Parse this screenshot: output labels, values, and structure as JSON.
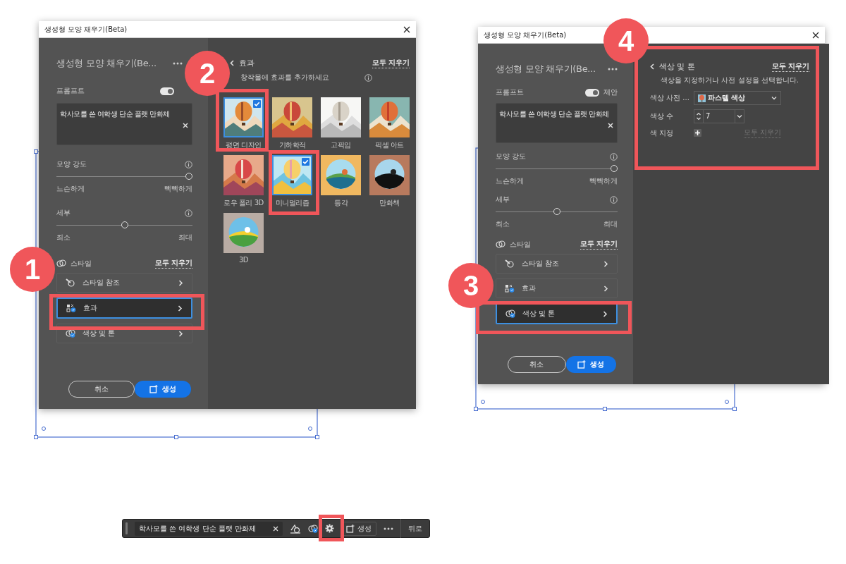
{
  "left_dialog": {
    "title": "생성형 모양 채우기(Beta)",
    "panel": {
      "heading": "생성형 모양 채우기(Be...",
      "prompt_label": "프롬프트",
      "suggest": {
        "on": true
      },
      "prompt_value": "학사모를 쓴 여학생 단순 플랫 만화체",
      "sliders": [
        {
          "label": "모양 강도",
          "min_label": "느슨하게",
          "max_label": "빽빽하게",
          "level": 1.0
        },
        {
          "label": "세부",
          "min_label": "최소",
          "max_label": "최대",
          "level": 0.5
        }
      ],
      "style_label": "스타일",
      "clear_all": "모두 지우기",
      "style_items": [
        {
          "label": "스타일 참조",
          "selected": false
        },
        {
          "label": "효과",
          "selected": true
        },
        {
          "label": "색상 및 톤",
          "selected": false
        }
      ],
      "cancel": "취소",
      "generate": "생성"
    },
    "effects": {
      "title": "효과",
      "clear_all": "모두 지우기",
      "subtitle": "창작물에 효과를 추가하세요",
      "items": [
        {
          "label": "평면 디자인",
          "selected": true
        },
        {
          "label": "기하학적",
          "selected": false
        },
        {
          "label": "고픽임",
          "selected": false
        },
        {
          "label": "픽셀 아트",
          "selected": false
        },
        {
          "label": "로우 폴리 3D",
          "selected": false
        },
        {
          "label": "미니멀리즘",
          "selected": true
        },
        {
          "label": "등각",
          "selected": false
        },
        {
          "label": "만화책",
          "selected": false
        },
        {
          "label": "3D",
          "selected": false
        }
      ]
    }
  },
  "right_dialog": {
    "title": "생성형 모양 채우기(Beta)",
    "panel": {
      "heading": "생성형 모양 채우기(Be...",
      "prompt_label": "프롬프트",
      "suggest": {
        "on": true,
        "label": "제안"
      },
      "prompt_value": "학사모를 쓴 여학생 단순 플랫 만화체",
      "sliders": [
        {
          "label": "모양 강도",
          "min_label": "느슨하게",
          "max_label": "빽빽하게",
          "level": 1.0
        },
        {
          "label": "세부",
          "min_label": "최소",
          "max_label": "최대",
          "level": 0.5
        }
      ],
      "style_label": "스타일",
      "clear_all": "모두 지우기",
      "style_items": [
        {
          "label": "스타일 참조",
          "selected": false
        },
        {
          "label": "효과",
          "selected": false
        },
        {
          "label": "색상 및 톤",
          "selected": true
        }
      ],
      "cancel": "취소",
      "generate": "생성"
    },
    "color_tone": {
      "title": "색상 및 톤",
      "clear_all": "모두 지우기",
      "subtitle": "색상을 지정하거나 사전 설정을 선택합니다.",
      "preset_label": "색상 사전 ...",
      "preset_value": "파스텔 색상",
      "count_label": "색상 수",
      "count_value": "7",
      "pick_label": "색 지정",
      "pick_clear": {
        "label": "모두 지우기",
        "disabled": true
      }
    }
  },
  "toolbar": {
    "prompt_value": "학사모를 쓴 여학생 단순 플랫 만화체",
    "generate": "생성",
    "back": "뒤로"
  },
  "callouts": [
    "1",
    "2",
    "3",
    "4"
  ]
}
